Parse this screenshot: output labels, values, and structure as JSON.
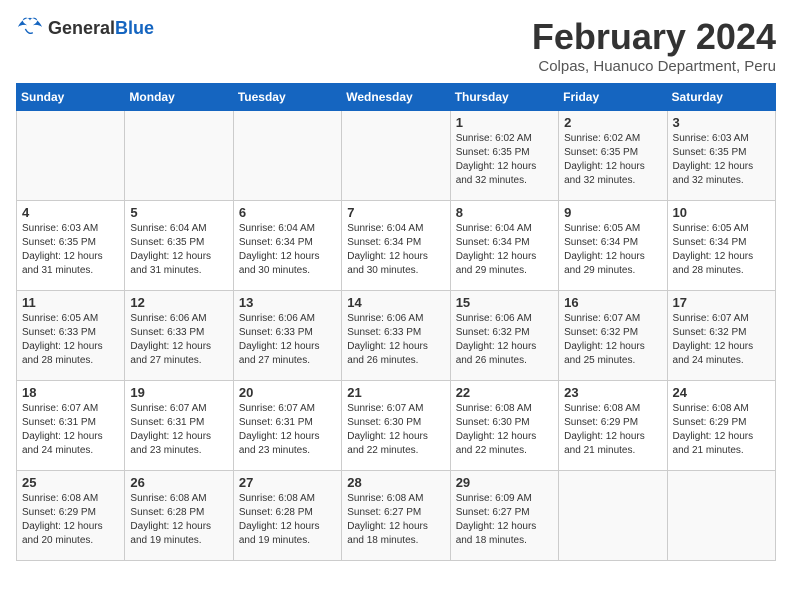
{
  "logo": {
    "general": "General",
    "blue": "Blue"
  },
  "title": "February 2024",
  "subtitle": "Colpas, Huanuco Department, Peru",
  "days_of_week": [
    "Sunday",
    "Monday",
    "Tuesday",
    "Wednesday",
    "Thursday",
    "Friday",
    "Saturday"
  ],
  "weeks": [
    [
      {
        "day": "",
        "info": ""
      },
      {
        "day": "",
        "info": ""
      },
      {
        "day": "",
        "info": ""
      },
      {
        "day": "",
        "info": ""
      },
      {
        "day": "1",
        "info": "Sunrise: 6:02 AM\nSunset: 6:35 PM\nDaylight: 12 hours\nand 32 minutes."
      },
      {
        "day": "2",
        "info": "Sunrise: 6:02 AM\nSunset: 6:35 PM\nDaylight: 12 hours\nand 32 minutes."
      },
      {
        "day": "3",
        "info": "Sunrise: 6:03 AM\nSunset: 6:35 PM\nDaylight: 12 hours\nand 32 minutes."
      }
    ],
    [
      {
        "day": "4",
        "info": "Sunrise: 6:03 AM\nSunset: 6:35 PM\nDaylight: 12 hours\nand 31 minutes."
      },
      {
        "day": "5",
        "info": "Sunrise: 6:04 AM\nSunset: 6:35 PM\nDaylight: 12 hours\nand 31 minutes."
      },
      {
        "day": "6",
        "info": "Sunrise: 6:04 AM\nSunset: 6:34 PM\nDaylight: 12 hours\nand 30 minutes."
      },
      {
        "day": "7",
        "info": "Sunrise: 6:04 AM\nSunset: 6:34 PM\nDaylight: 12 hours\nand 30 minutes."
      },
      {
        "day": "8",
        "info": "Sunrise: 6:04 AM\nSunset: 6:34 PM\nDaylight: 12 hours\nand 29 minutes."
      },
      {
        "day": "9",
        "info": "Sunrise: 6:05 AM\nSunset: 6:34 PM\nDaylight: 12 hours\nand 29 minutes."
      },
      {
        "day": "10",
        "info": "Sunrise: 6:05 AM\nSunset: 6:34 PM\nDaylight: 12 hours\nand 28 minutes."
      }
    ],
    [
      {
        "day": "11",
        "info": "Sunrise: 6:05 AM\nSunset: 6:33 PM\nDaylight: 12 hours\nand 28 minutes."
      },
      {
        "day": "12",
        "info": "Sunrise: 6:06 AM\nSunset: 6:33 PM\nDaylight: 12 hours\nand 27 minutes."
      },
      {
        "day": "13",
        "info": "Sunrise: 6:06 AM\nSunset: 6:33 PM\nDaylight: 12 hours\nand 27 minutes."
      },
      {
        "day": "14",
        "info": "Sunrise: 6:06 AM\nSunset: 6:33 PM\nDaylight: 12 hours\nand 26 minutes."
      },
      {
        "day": "15",
        "info": "Sunrise: 6:06 AM\nSunset: 6:32 PM\nDaylight: 12 hours\nand 26 minutes."
      },
      {
        "day": "16",
        "info": "Sunrise: 6:07 AM\nSunset: 6:32 PM\nDaylight: 12 hours\nand 25 minutes."
      },
      {
        "day": "17",
        "info": "Sunrise: 6:07 AM\nSunset: 6:32 PM\nDaylight: 12 hours\nand 24 minutes."
      }
    ],
    [
      {
        "day": "18",
        "info": "Sunrise: 6:07 AM\nSunset: 6:31 PM\nDaylight: 12 hours\nand 24 minutes."
      },
      {
        "day": "19",
        "info": "Sunrise: 6:07 AM\nSunset: 6:31 PM\nDaylight: 12 hours\nand 23 minutes."
      },
      {
        "day": "20",
        "info": "Sunrise: 6:07 AM\nSunset: 6:31 PM\nDaylight: 12 hours\nand 23 minutes."
      },
      {
        "day": "21",
        "info": "Sunrise: 6:07 AM\nSunset: 6:30 PM\nDaylight: 12 hours\nand 22 minutes."
      },
      {
        "day": "22",
        "info": "Sunrise: 6:08 AM\nSunset: 6:30 PM\nDaylight: 12 hours\nand 22 minutes."
      },
      {
        "day": "23",
        "info": "Sunrise: 6:08 AM\nSunset: 6:29 PM\nDaylight: 12 hours\nand 21 minutes."
      },
      {
        "day": "24",
        "info": "Sunrise: 6:08 AM\nSunset: 6:29 PM\nDaylight: 12 hours\nand 21 minutes."
      }
    ],
    [
      {
        "day": "25",
        "info": "Sunrise: 6:08 AM\nSunset: 6:29 PM\nDaylight: 12 hours\nand 20 minutes."
      },
      {
        "day": "26",
        "info": "Sunrise: 6:08 AM\nSunset: 6:28 PM\nDaylight: 12 hours\nand 19 minutes."
      },
      {
        "day": "27",
        "info": "Sunrise: 6:08 AM\nSunset: 6:28 PM\nDaylight: 12 hours\nand 19 minutes."
      },
      {
        "day": "28",
        "info": "Sunrise: 6:08 AM\nSunset: 6:27 PM\nDaylight: 12 hours\nand 18 minutes."
      },
      {
        "day": "29",
        "info": "Sunrise: 6:09 AM\nSunset: 6:27 PM\nDaylight: 12 hours\nand 18 minutes."
      },
      {
        "day": "",
        "info": ""
      },
      {
        "day": "",
        "info": ""
      }
    ]
  ]
}
